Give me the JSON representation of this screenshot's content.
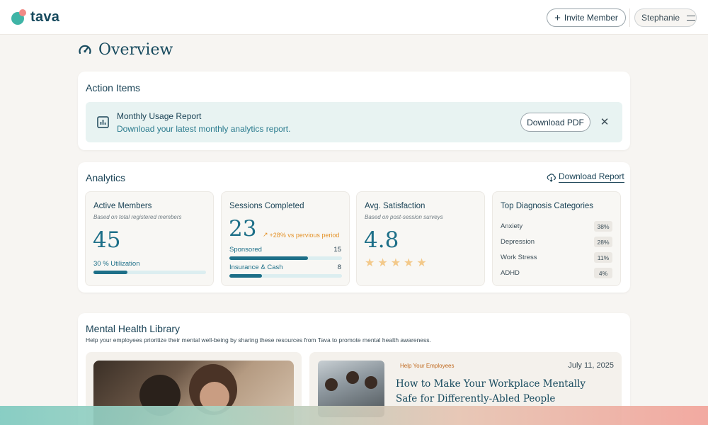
{
  "brand": {
    "name": "tava",
    "teal": "#3fb4a6",
    "coral": "#f08a86",
    "primary": "#174a5e",
    "accent": "#1d6f88"
  },
  "header": {
    "invite_label": "Invite Member",
    "user_name": "Stephanie"
  },
  "page": {
    "title": "Overview"
  },
  "action_items": {
    "title": "Action Items",
    "item": {
      "title": "Monthly Usage Report",
      "subtitle": "Download your latest monthly analytics report.",
      "button_label": "Download PDF",
      "dismiss_symbol": "✕"
    }
  },
  "analytics": {
    "title": "Analytics",
    "download_label": "Download Report",
    "active_members": {
      "title": "Active Members",
      "subtitle": "Based on total registered members",
      "value": "45",
      "utilization_label": "30 % Utilization",
      "utilization_fraction": 0.3
    },
    "sessions": {
      "title": "Sessions Completed",
      "value": "23",
      "delta": "+28% vs pervious period",
      "rows": [
        {
          "label": "Sponsored",
          "value": "15",
          "fraction": 0.7
        },
        {
          "label": "Insurance & Cash",
          "value": "8",
          "fraction": 0.29
        }
      ]
    },
    "satisfaction": {
      "title": "Avg. Satisfaction",
      "subtitle": "Based on post-session surveys",
      "value": "4.8",
      "stars": 5
    },
    "diagnosis": {
      "title": "Top Diagnosis Categories",
      "items": [
        {
          "label": "Anxiety",
          "value": "38%"
        },
        {
          "label": "Depression",
          "value": "28%"
        },
        {
          "label": "Work Stress",
          "value": "11%"
        },
        {
          "label": "ADHD",
          "value": "4%"
        }
      ]
    }
  },
  "library": {
    "title": "Mental Health Library",
    "subtitle": "Help your employees prioritize their mental well-being by sharing these resources from Tava to promote mental health awareness.",
    "article": {
      "tag": "Help Your Employees",
      "date": "July 11, 2025",
      "title": "How to Make Your Workplace Mentally Safe for Differently-Abled People"
    }
  }
}
